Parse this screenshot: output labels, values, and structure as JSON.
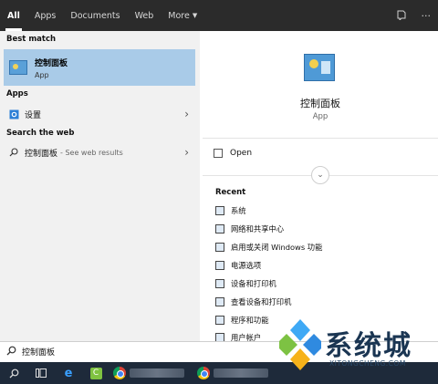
{
  "tabs": [
    {
      "label": "All",
      "active": true
    },
    {
      "label": "Apps"
    },
    {
      "label": "Documents"
    },
    {
      "label": "Web"
    },
    {
      "label": "More"
    }
  ],
  "top_icons": [
    "feedback-icon",
    "more-options-icon"
  ],
  "left": {
    "best_match_heading": "Best match",
    "best_match": {
      "title": "控制面板",
      "subtitle": "App",
      "icon": "control-panel-icon"
    },
    "apps_heading": "Apps",
    "apps": [
      {
        "label": "设置",
        "icon": "settings-icon"
      }
    ],
    "web_heading": "Search the web",
    "web": [
      {
        "label": "控制面板",
        "suffix": "- See web results",
        "icon": "search-icon"
      }
    ]
  },
  "right": {
    "app_title": "控制面板",
    "app_subtitle": "App",
    "open_label": "Open",
    "recent_heading": "Recent",
    "recent": [
      "系统",
      "网络和共享中心",
      "启用或关闭 Windows 功能",
      "电源选项",
      "设备和打印机",
      "查看设备和打印机",
      "程序和功能",
      "用户帐户"
    ]
  },
  "search": {
    "value": "控制面板"
  },
  "taskbar": [
    "search-icon",
    "task-view-icon",
    "edge-icon",
    "camtasia-icon",
    "chrome-icon",
    "chrome-icon"
  ],
  "watermark": {
    "brand": "系统城",
    "url": "XITONGCHENG.COM"
  },
  "colors": {
    "accent": "#a9cbe8",
    "topbar": "#2b2b2b",
    "taskbar": "#1e2a3a",
    "left_panel": "#f1f1f1"
  }
}
